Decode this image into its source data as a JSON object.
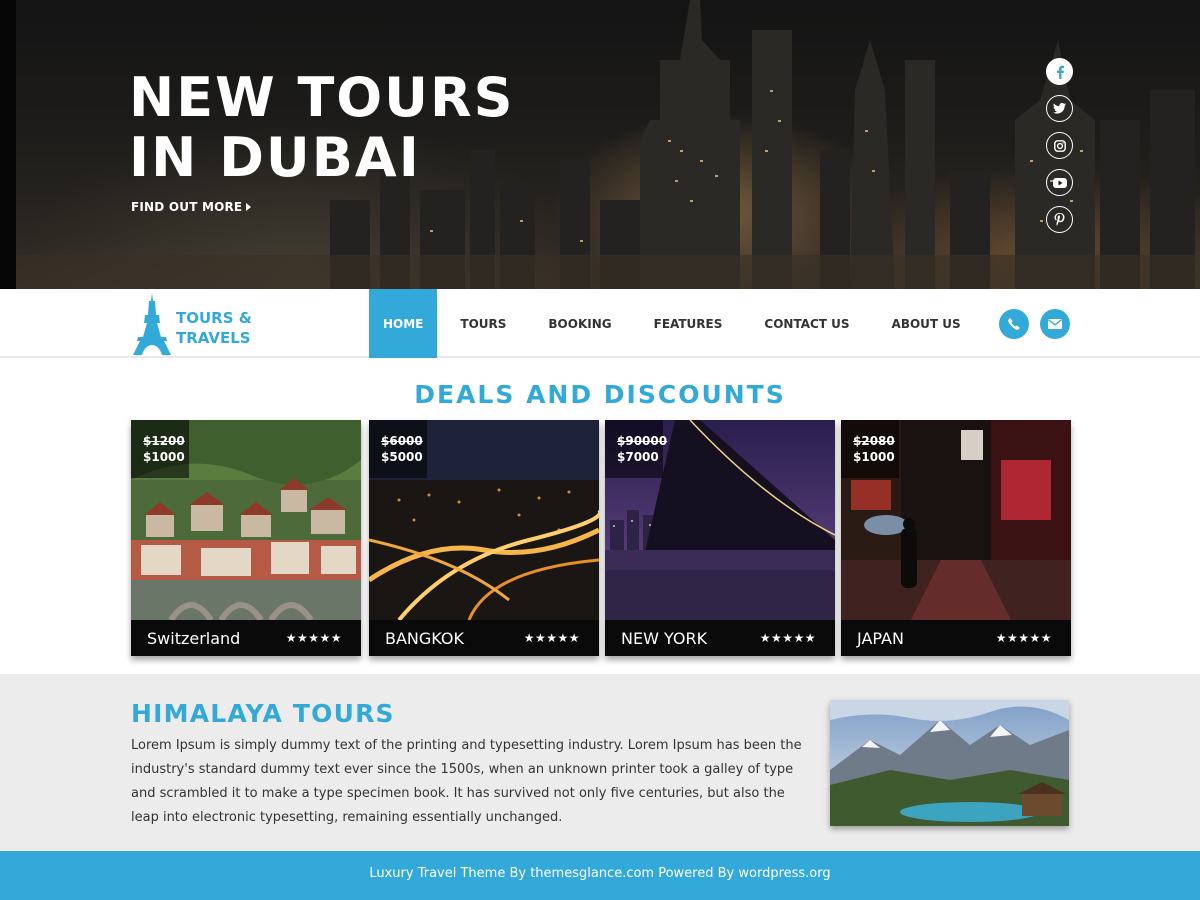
{
  "hero": {
    "title_line1": "NEW TOURS",
    "title_line2": "IN DUBAI",
    "cta": "FIND OUT MORE",
    "social_icons": [
      "facebook-icon",
      "twitter-icon",
      "instagram-icon",
      "youtube-icon",
      "pinterest-icon"
    ]
  },
  "nav": {
    "logo_line1": "TOURS &",
    "logo_line2": "TRAVELS",
    "menu": [
      {
        "label": "HOME",
        "active": true
      },
      {
        "label": "TOURS"
      },
      {
        "label": "BOOKING"
      },
      {
        "label": "FEATURES"
      },
      {
        "label": "CONTACT US"
      },
      {
        "label": "ABOUT US"
      }
    ],
    "icons": [
      "phone-icon",
      "envelope-icon"
    ]
  },
  "deals": {
    "title": "DEALS AND DISCOUNTS",
    "cards": [
      {
        "name": "Switzerland",
        "old_price": "$1200",
        "price": "$1000",
        "stars": "★★★★★"
      },
      {
        "name": "BANGKOK",
        "old_price": "$6000",
        "price": "$5000",
        "stars": "★★★★★"
      },
      {
        "name": "NEW YORK",
        "old_price": "$90000",
        "price": "$7000",
        "stars": "★★★★★"
      },
      {
        "name": "JAPAN",
        "old_price": "$2080",
        "price": "$1000",
        "stars": "★★★★★"
      }
    ]
  },
  "info": {
    "title": "HIMALAYA TOURS",
    "text": "Lorem Ipsum is simply dummy text of the printing and typesetting industry. Lorem Ipsum has been the industry's standard dummy text ever since the 1500s, when an unknown printer took a galley of type and scrambled it to make a type specimen book. It has survived not only five centuries, but also the leap into electronic typesetting, remaining essentially unchanged."
  },
  "footer": {
    "text": "Luxury Travel Theme By themesglance.com Powered By wordpress.org"
  },
  "colors": {
    "accent": "#33a9d9",
    "dark": "#0a0a0a",
    "light_bg": "#ececec"
  }
}
